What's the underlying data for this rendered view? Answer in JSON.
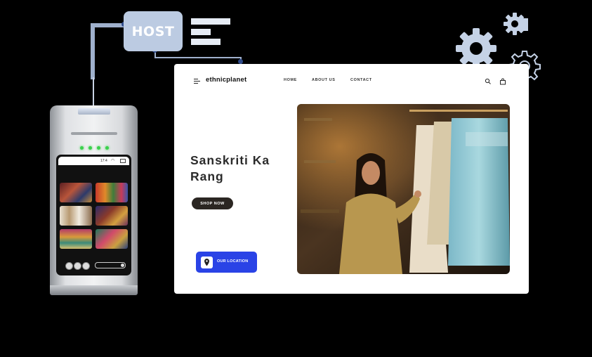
{
  "host": {
    "label": "HOST"
  },
  "website": {
    "logo": "ethnicplanet",
    "nav": [
      "HOME",
      "ABOUT US",
      "CONTACT"
    ],
    "hero_title": "Sanskriti Ka Rang",
    "shop_button": "SHOP NOW",
    "location_button": "OUR LOCATION"
  },
  "kiosk": {
    "status_time": "17:4"
  },
  "colors": {
    "accent_blue": "#2a43e6",
    "host_box": "#bccbe2",
    "gear": "#c5d2e6",
    "led_green": "#3bd14d",
    "dark_button": "#2b2622"
  }
}
